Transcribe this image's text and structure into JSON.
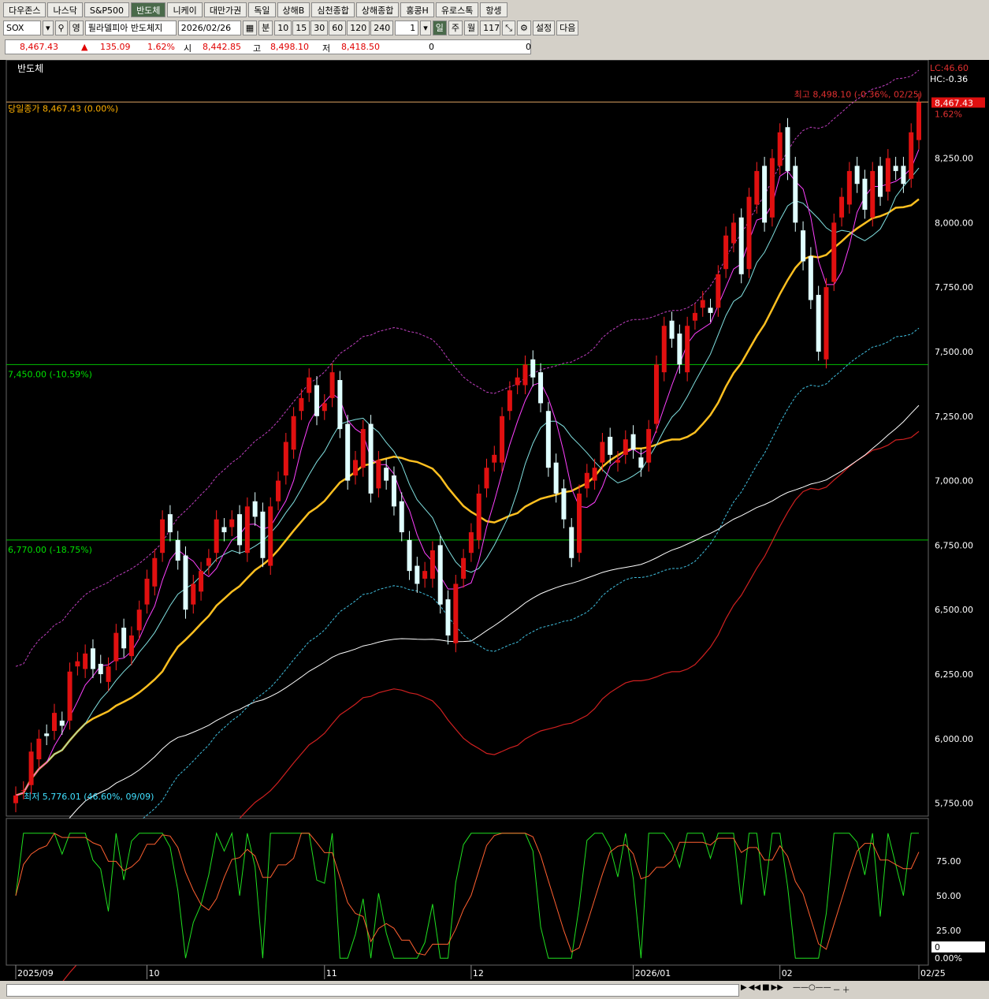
{
  "tabs": [
    "다우존스",
    "나스닥",
    "S&P500",
    "반도체",
    "니케이",
    "대만가권",
    "독일",
    "상해B",
    "심천종합",
    "상해종합",
    "홍콩H",
    "유로스톡",
    "항셍"
  ],
  "active_tab": 3,
  "toolbar": {
    "symbol": "SOX",
    "mode": "영",
    "name": "필라델피아 반도체지",
    "date": "2026/02/26",
    "unit_minute": "분",
    "periods": [
      "10",
      "15",
      "30",
      "60",
      "120",
      "240"
    ],
    "multiplier": "1",
    "day": "일",
    "week": "주",
    "month": "월",
    "count": "117",
    "settings": "설정",
    "next": "다음"
  },
  "quote": {
    "price": "8,467.43",
    "arrow": "▲",
    "change": "135.09",
    "pct": "1.62%",
    "open_label": "시",
    "open": "8,442.85",
    "high_label": "고",
    "high": "8,498.10",
    "low_label": "저",
    "low": "8,418.50",
    "vol1": "0",
    "vol2": "0"
  },
  "chart_data": {
    "type": "candlestick",
    "title": "반도체",
    "ylim": [
      5700,
      8600
    ],
    "yticks": [
      "8,250.00",
      "8,000.00",
      "7,750.00",
      "7,500.00",
      "7,250.00",
      "7,000.00",
      "6,750.00",
      "6,500.00",
      "6,250.00",
      "6,000.00",
      "5,750.00"
    ],
    "ytick_values": [
      8250,
      8000,
      7750,
      7500,
      7250,
      7000,
      6750,
      6500,
      6250,
      6000,
      5750
    ],
    "x_labels": [
      "2025/09",
      "10",
      "11",
      "12",
      "2026/01",
      "02",
      "02/25"
    ],
    "x_label_index": [
      0,
      17,
      40,
      59,
      80,
      99,
      117
    ],
    "close_line_label": "당일종가 8,467.43 (0.00%)",
    "close_line_value": 8467.43,
    "h_lines": [
      {
        "label": "7,450.00 (-10.59%)",
        "value": 7450
      },
      {
        "label": "6,770.00 (-18.75%)",
        "value": 6770
      }
    ],
    "high_note": "최고 8,498.10 (-0.36%, 02/25)",
    "low_note": "최저 5,776.01 (46.60%, 09/09)",
    "right_labels": {
      "lc": "LC:46.60",
      "hc": "HC:-0.36",
      "last": "8,467.43",
      "pct": "1.62%"
    },
    "closes": [
      5780,
      5800,
      5950,
      6000,
      6010,
      6100,
      6050,
      6260,
      6300,
      6330,
      6270,
      6250,
      6280,
      6410,
      6350,
      6400,
      6500,
      6620,
      6700,
      6850,
      6800,
      6690,
      6500,
      6600,
      6650,
      6700,
      6850,
      6800,
      6850,
      6750,
      6900,
      6860,
      6700,
      6900,
      7000,
      7150,
      7250,
      7320,
      7400,
      7250,
      7300,
      7420,
      7200,
      7000,
      7080,
      7200,
      6950,
      7080,
      7000,
      6900,
      6800,
      6650,
      6600,
      6650,
      6730,
      6520,
      6400,
      6600,
      6700,
      6800,
      6950,
      7050,
      7100,
      7250,
      7350,
      7400,
      7450,
      7400,
      7300,
      7050,
      6950,
      6850,
      6700,
      6950,
      7030,
      7050,
      7150,
      7100,
      7080,
      7160,
      7120,
      7050,
      7200,
      7450,
      7600,
      7550,
      7450,
      7600,
      7650,
      7700,
      7650,
      7800,
      7950,
      8000,
      7800,
      8100,
      8200,
      8000,
      8250,
      8350,
      8200,
      8000,
      7850,
      7700,
      7500,
      7750,
      8000,
      8100,
      8200,
      8150,
      8050,
      8200,
      8100,
      8250,
      8200,
      8150,
      8350,
      8467
    ]
  },
  "oscillator": {
    "yticks": [
      "75.00",
      "50.00",
      "25.00"
    ],
    "ytick_values": [
      75,
      50,
      25
    ],
    "value_label": "0",
    "pct_label": "0.00%"
  }
}
